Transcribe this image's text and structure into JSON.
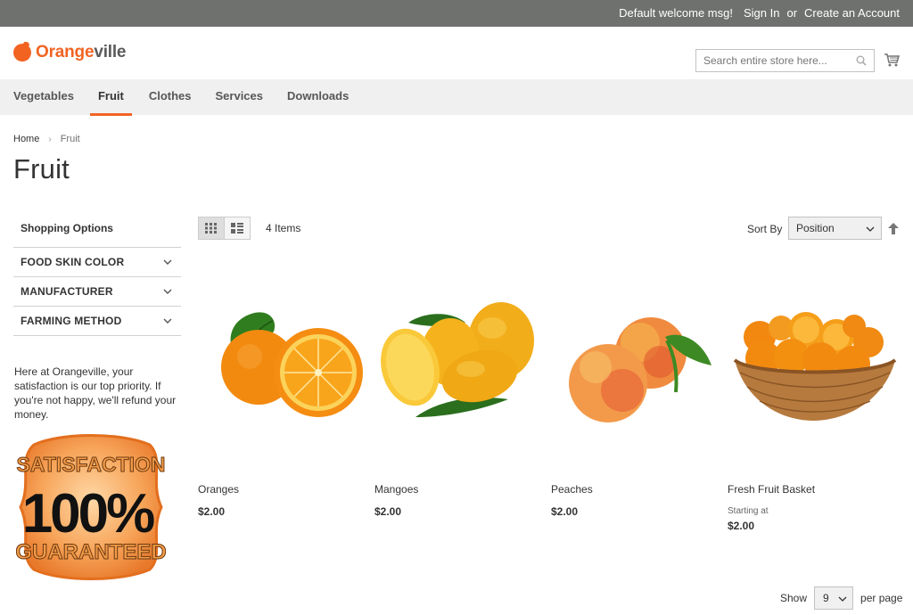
{
  "topbar": {
    "welcome": "Default welcome msg!",
    "sign_in": "Sign In",
    "or": "or",
    "create_account": "Create an Account"
  },
  "header": {
    "logo_part1": "Orange",
    "logo_part2": "ville",
    "search_placeholder": "Search entire store here..."
  },
  "nav": {
    "items": [
      "Vegetables",
      "Fruit",
      "Clothes",
      "Services",
      "Downloads"
    ],
    "active": "Fruit"
  },
  "breadcrumb": {
    "home": "Home",
    "current": "Fruit"
  },
  "page_title": "Fruit",
  "sidebar": {
    "title": "Shopping Options",
    "filters": [
      "FOOD SKIN COLOR",
      "MANUFACTURER",
      "FARMING METHOD"
    ],
    "promo_text": "Here at Orangeville, your satisfaction is our top priority. If you're not happy, we'll refund your money.",
    "badge": {
      "line1": "SATISFACTION",
      "line2": "100%",
      "line3": "GUARANTEED"
    }
  },
  "toolbar": {
    "items_count": "4 Items",
    "sort_label": "Sort By",
    "sort_value": "Position"
  },
  "products": [
    {
      "name": "Oranges",
      "price": "$2.00",
      "starting": ""
    },
    {
      "name": "Mangoes",
      "price": "$2.00",
      "starting": ""
    },
    {
      "name": "Peaches",
      "price": "$2.00",
      "starting": ""
    },
    {
      "name": "Fresh Fruit Basket",
      "price": "$2.00",
      "starting": "Starting at"
    }
  ],
  "pager": {
    "show": "Show",
    "limit": "9",
    "per_page": "per page"
  },
  "colors": {
    "accent": "#f26322",
    "topbar": "#6e716e",
    "nav_bg": "#f0f0f0"
  }
}
